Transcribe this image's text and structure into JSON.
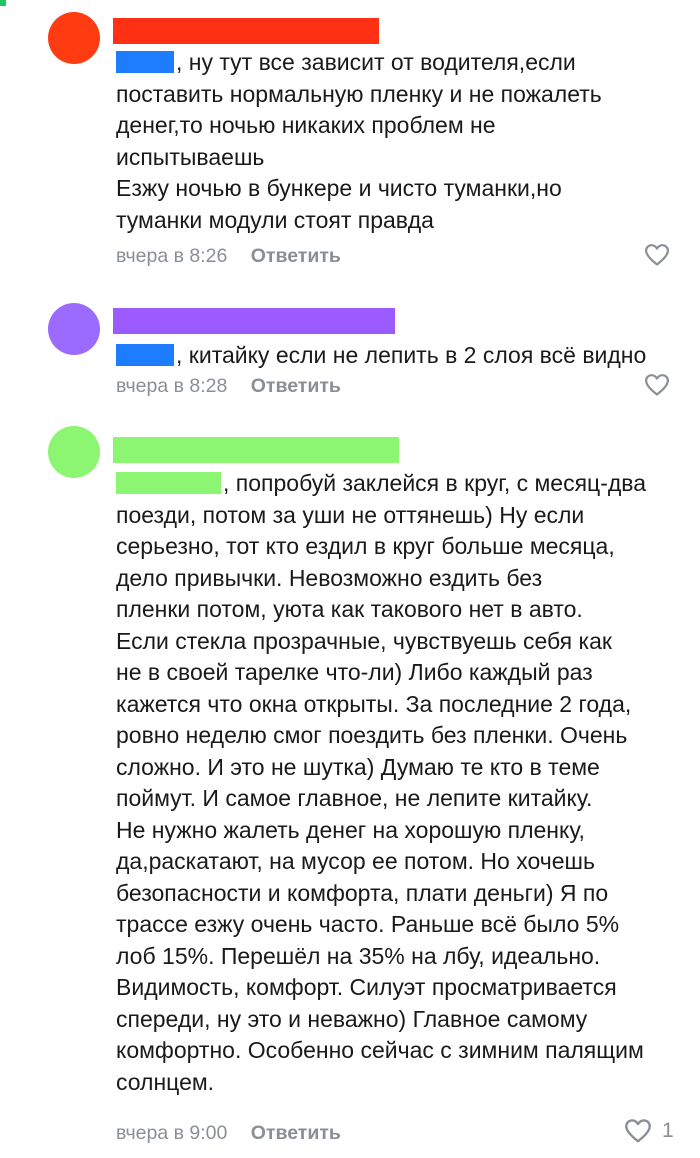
{
  "colors": {
    "comment1_avatar": "#ff3b12",
    "comment1_name": "#ff3014",
    "comment1_mention": "#1e7cff",
    "comment2_avatar": "#9b6bff",
    "comment2_name": "#9b5bff",
    "comment2_mention": "#1e7cff",
    "comment3_avatar": "#8cf572",
    "comment3_name": "#8cf572",
    "comment3_mention": "#8cf572",
    "meta_text": "#8a8f96",
    "like_icon": "#8a8f96"
  },
  "comments": [
    {
      "text": ", ну тут все зависит от водителя,если\nпоставить нормальную пленку и не пожалеть\nденег,то ночью никаких проблем не\nиспытываешь\nЕзжу ночью в бункере и чисто туманки,но\nтуманки модули стоят правда",
      "time": "вчера в 8:26",
      "reply_label": "Ответить",
      "like_icon": "heart-outline-icon"
    },
    {
      "text": ", китайку если не лепить в 2 слоя всё видно",
      "time": "вчера в 8:28",
      "reply_label": "Ответить",
      "like_icon": "heart-outline-icon"
    },
    {
      "text": ", попробуй заклейся в круг, с месяц-два\nпоезди, потом за уши не оттянешь) Ну если\nсерьезно, тот кто ездил в круг больше месяца,\nдело привычки. Невозможно ездить без\nпленки потом, уюта как такового нет в авто.\nЕсли стекла прозрачные, чувствуешь себя как\nне в своей тарелке что-ли) Либо каждый раз\nкажется что окна открыты. За последние 2 года,\nровно неделю смог поездить без пленки. Очень\nсложно. И это не шутка) Думаю те кто в теме\nпоймут. И самое главное, не лепите китайку.\nНе нужно жалеть денег на хорошую пленку,\nда,раскатают, на мусор ее потом. Но хочешь\nбезопасности и комфорта, плати деньги) Я по\nтрассе езжу очень часто. Раньше всё было 5%\nлоб 15%. Перешёл на 35% на лбу, идеально.\nВидимость, комфорт. Силуэт просматривается\nспереди, ну это и неважно) Главное самому\nкомфортно. Особенно сейчас с зимним палящим\nсолнцем.",
      "time": "вчера в 9:00",
      "reply_label": "Ответить",
      "like_icon": "heart-outline-icon",
      "like_count": "1"
    }
  ]
}
